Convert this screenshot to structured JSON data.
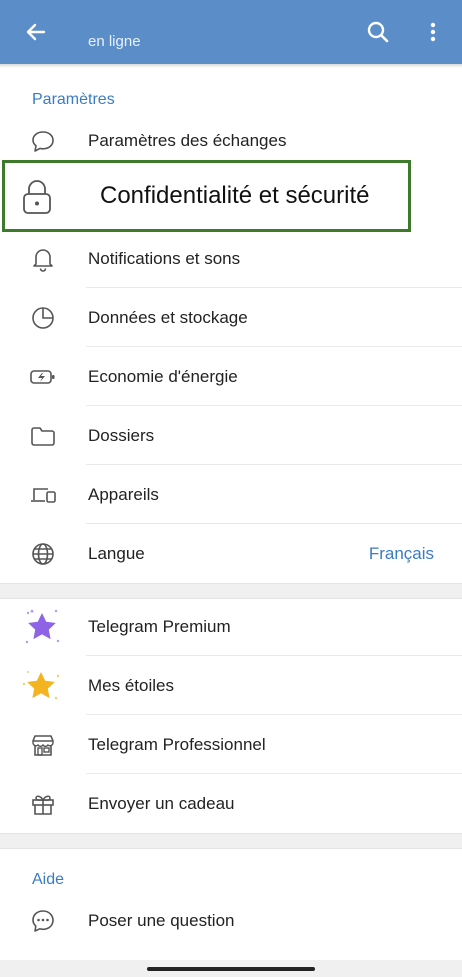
{
  "header": {
    "status": "en ligne"
  },
  "sections": {
    "settings_title": "Paramètres",
    "help_title": "Aide"
  },
  "items": {
    "chat_settings": "Paramètres des échanges",
    "privacy": "Confidentialité et sécurité",
    "notifications": "Notifications et sons",
    "data": "Données et stockage",
    "power": "Economie d'énergie",
    "folders": "Dossiers",
    "devices": "Appareils",
    "language": "Langue",
    "language_value": "Français",
    "premium": "Telegram Premium",
    "stars": "Mes étoiles",
    "business": "Telegram Professionnel",
    "gift": "Envoyer un cadeau",
    "ask": "Poser une question"
  },
  "colors": {
    "header": "#5b8ec9",
    "accent": "#3a7cc4",
    "highlight_border": "#3d7a2b",
    "premium_star": "#8e63e6",
    "gold_star": "#f4b321"
  }
}
